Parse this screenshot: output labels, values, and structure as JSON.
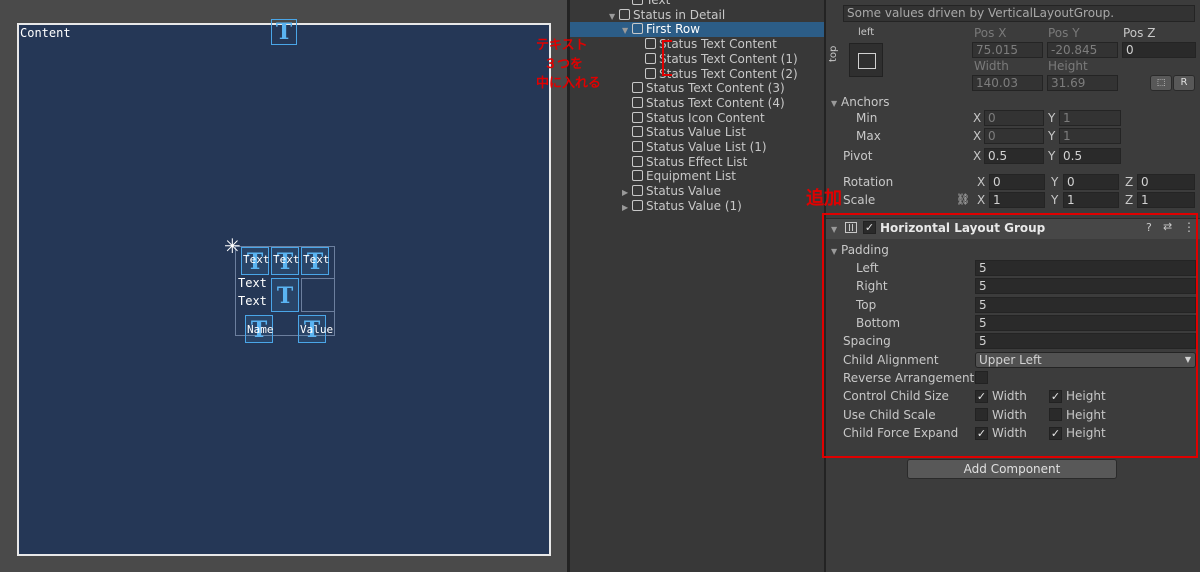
{
  "scene": {
    "content_label": "Content",
    "row_texts": [
      "Text",
      "Text",
      "Text"
    ],
    "left_texts": [
      "Text",
      "Text"
    ],
    "value_texts": [
      "Name",
      "Value"
    ]
  },
  "hierarchy": {
    "items": [
      {
        "label": "Text",
        "indent": 5,
        "selected": false,
        "arrow": ""
      },
      {
        "label": "Status in Detail",
        "indent": 4,
        "selected": false,
        "arrow": "▼"
      },
      {
        "label": "First Row",
        "indent": 5,
        "selected": true,
        "arrow": "▼"
      },
      {
        "label": "Status Text Content",
        "indent": 6,
        "selected": false,
        "arrow": ""
      },
      {
        "label": "Status Text Content (1)",
        "indent": 6,
        "selected": false,
        "arrow": ""
      },
      {
        "label": "Status Text Content (2)",
        "indent": 6,
        "selected": false,
        "arrow": ""
      },
      {
        "label": "Status Text Content (3)",
        "indent": 5,
        "selected": false,
        "arrow": ""
      },
      {
        "label": "Status Text Content (4)",
        "indent": 5,
        "selected": false,
        "arrow": ""
      },
      {
        "label": "Status Icon Content",
        "indent": 5,
        "selected": false,
        "arrow": ""
      },
      {
        "label": "Status Value List",
        "indent": 5,
        "selected": false,
        "arrow": ""
      },
      {
        "label": "Status Value List (1)",
        "indent": 5,
        "selected": false,
        "arrow": ""
      },
      {
        "label": "Status Effect List",
        "indent": 5,
        "selected": false,
        "arrow": ""
      },
      {
        "label": "Equipment List",
        "indent": 5,
        "selected": false,
        "arrow": ""
      },
      {
        "label": "Status Value",
        "indent": 5,
        "selected": false,
        "arrow": "▶"
      },
      {
        "label": "Status Value (1)",
        "indent": 5,
        "selected": false,
        "arrow": "▶"
      }
    ],
    "annotation_lines": [
      "テキスト",
      "３つを",
      "中に入れる"
    ]
  },
  "inspector": {
    "driven_note": "Some values driven by VerticalLayoutGroup.",
    "anchor_preset": {
      "h": "left",
      "v": "top"
    },
    "pos_x_label": "Pos X",
    "pos_y_label": "Pos Y",
    "pos_z_label": "Pos Z",
    "pos_x": "75.015",
    "pos_y": "-20.845",
    "pos_z": "0",
    "width_label": "Width",
    "height_label": "Height",
    "width": "140.03",
    "height": "31.69",
    "r_button": "R",
    "anchors_label": "Anchors",
    "min_label": "Min",
    "max_label": "Max",
    "min_x": "0",
    "min_y": "1",
    "max_x": "0",
    "max_y": "1",
    "pivot_label": "Pivot",
    "pivot_x": "0.5",
    "pivot_y": "0.5",
    "rotation_label": "Rotation",
    "rot_x": "0",
    "rot_y": "0",
    "rot_z": "0",
    "scale_label": "Scale",
    "scale_x": "1",
    "scale_y": "1",
    "scale_z": "1",
    "axis": {
      "x": "X",
      "y": "Y",
      "z": "Z"
    },
    "added_annotation": "追加",
    "component": {
      "title": "Horizontal Layout Group",
      "padding_label": "Padding",
      "left_label": "Left",
      "left": "5",
      "right_label": "Right",
      "right": "5",
      "top_label": "Top",
      "top": "5",
      "bottom_label": "Bottom",
      "bottom": "5",
      "spacing_label": "Spacing",
      "spacing": "5",
      "child_alignment_label": "Child Alignment",
      "child_alignment": "Upper Left",
      "reverse_label": "Reverse Arrangement",
      "control_size_label": "Control Child Size",
      "use_scale_label": "Use Child Scale",
      "force_expand_label": "Child Force Expand",
      "width_opt": "Width",
      "height_opt": "Height",
      "check_mark": "✓"
    },
    "add_component": "Add Component"
  },
  "colors": {
    "selection": "#2c5d87",
    "annotation": "#e00000",
    "canvas": "#253756",
    "text_icon": "#5ab4f2"
  }
}
